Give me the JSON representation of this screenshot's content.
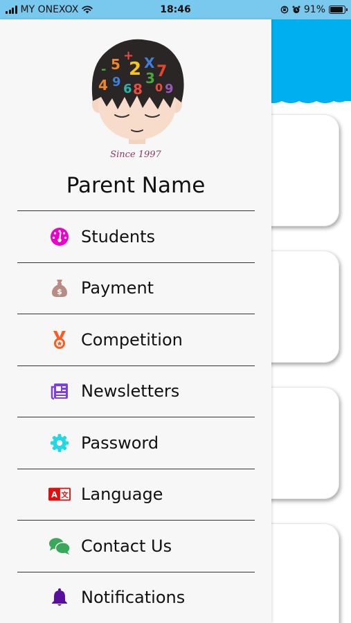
{
  "status_bar": {
    "carrier": "MY ONEXOX",
    "time": "18:46",
    "battery": "91%",
    "battery_level": 0.91
  },
  "drawer": {
    "logo_tagline": "Since 1997",
    "parent_name": "Parent Name",
    "menu": [
      {
        "label": "Students",
        "icon": "dashboard-gauge-icon",
        "color": "#ee00cc"
      },
      {
        "label": "Payment",
        "icon": "money-bag-icon",
        "color": "#b88c84"
      },
      {
        "label": "Competition",
        "icon": "medal-icon",
        "color": "#ff5a1f"
      },
      {
        "label": "Newsletters",
        "icon": "newspaper-icon",
        "color": "#7b3fe4"
      },
      {
        "label": "Password",
        "icon": "gear-icon",
        "color": "#22d8e6"
      },
      {
        "label": "Language",
        "icon": "language-icon",
        "color": "#e01010"
      },
      {
        "label": "Contact Us",
        "icon": "chat-bubbles-icon",
        "color": "#3aa85a"
      },
      {
        "label": "Notifications",
        "icon": "bell-icon",
        "color": "#5a0f9c"
      }
    ]
  },
  "colors": {
    "status_bar_bg": "#79c8ee",
    "header_bg": "#00aff0",
    "drawer_bg": "#f7f7f7"
  }
}
